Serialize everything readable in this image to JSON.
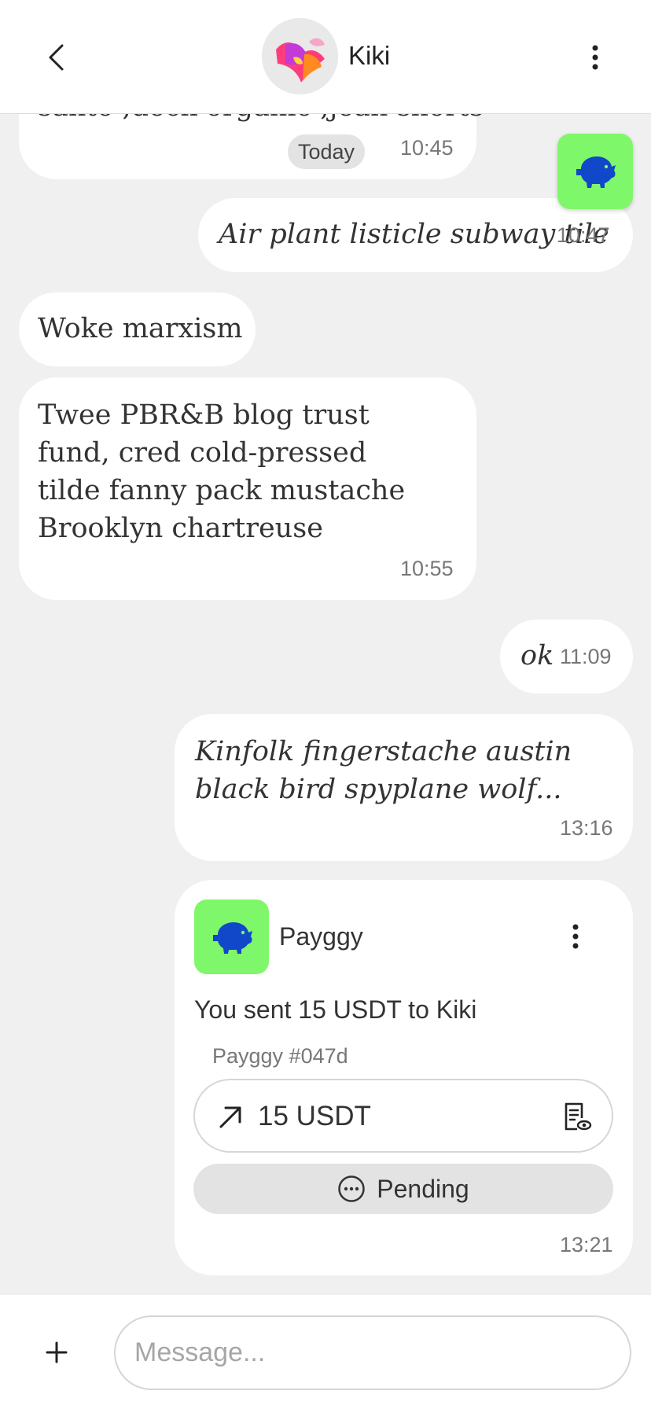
{
  "header": {
    "contact_name": "Kiki",
    "back_icon": "chevron-left-icon",
    "menu_icon": "more-vertical-icon"
  },
  "messages": {
    "m1": {
      "partial_text": "santo ,deck organic ,jean shorts",
      "badge": "Today",
      "time": "10:45"
    },
    "m2": {
      "text": "Air plant listicle subway tile",
      "time": "10:47"
    },
    "m3": {
      "text": "Woke marxism"
    },
    "m4": {
      "text": "Twee PBR&B blog trust fund, cred cold-pressed tilde fanny pack mustache Brooklyn chartreuse",
      "time": "10:55"
    },
    "m5": {
      "text": "ok",
      "time": "11:09"
    },
    "m6": {
      "text": "Kinfolk fingerstache austin black bird spyplane wolf...",
      "time": "13:16"
    }
  },
  "payment_card": {
    "bot_name": "Payggy",
    "sent_text": "You sent 15 USDT to Kiki",
    "reference": "Payggy #047d",
    "amount": "15 USDT",
    "status": "Pending",
    "time": "13:21",
    "icons": [
      "piggy-bank-icon",
      "arrow-up-right-icon",
      "receipt-view-icon",
      "pending-icon"
    ]
  },
  "composer": {
    "placeholder": "Message..."
  },
  "colors": {
    "accent_green": "#7ff76a",
    "piggy_blue": "#1147c9",
    "bubble": "#ffffff",
    "background": "#f0f0f0"
  }
}
